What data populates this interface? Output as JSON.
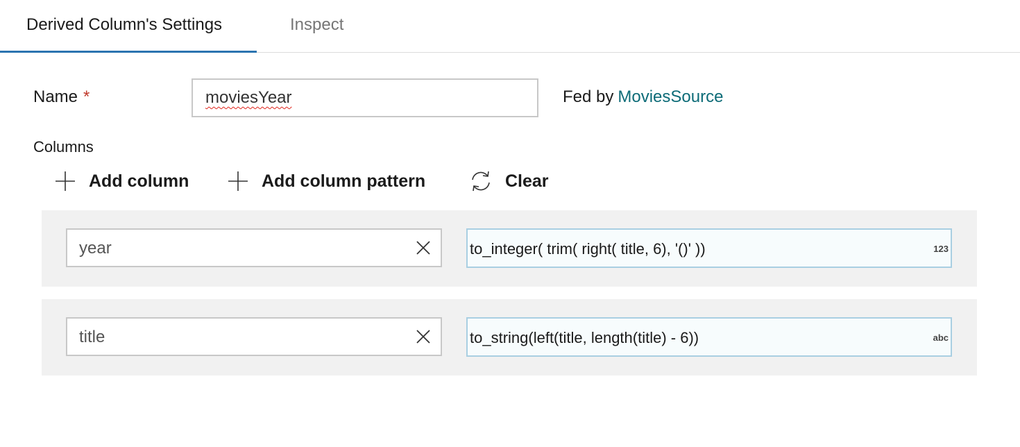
{
  "tabs": [
    {
      "label": "Derived Column's Settings",
      "active": true
    },
    {
      "label": "Inspect",
      "active": false
    }
  ],
  "form": {
    "name_label": "Name",
    "required_marker": "*",
    "name_value": "moviesYear",
    "fed_by_label": "Fed by",
    "fed_by_source": "MoviesSource"
  },
  "columns_section": {
    "label": "Columns",
    "toolbar": {
      "add_column": "Add column",
      "add_column_pattern": "Add column pattern",
      "clear": "Clear"
    },
    "rows": [
      {
        "name": "year",
        "expression": "to_integer( trim( right( title, 6), '()' ))",
        "type_badge": "123"
      },
      {
        "name": "title",
        "expression": "to_string(left(title, length(title) - 6))",
        "type_badge": "abc"
      }
    ]
  },
  "icons": {
    "add": "plus-icon",
    "pattern": "plus-icon",
    "clear": "refresh-icon",
    "remove": "close-icon"
  },
  "colors": {
    "tab_underline": "#2b74b0",
    "link": "#0e6c78",
    "required": "#c0392b",
    "expression_border": "#a9cfe2",
    "row_background": "#f1f1f1"
  }
}
